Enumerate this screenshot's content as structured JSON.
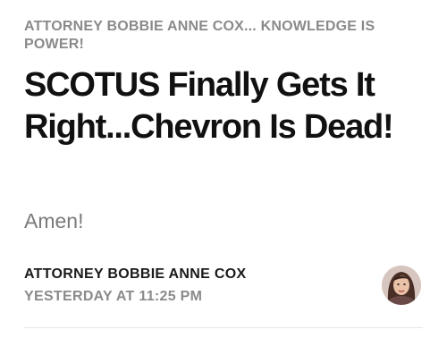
{
  "publication": {
    "name": "ATTORNEY BOBBIE ANNE COX... KNOWLEDGE IS POWER!"
  },
  "post": {
    "title": "SCOTUS Finally Gets It Right...Chevron Is Dead!",
    "subtitle": "Amen!"
  },
  "byline": {
    "author": "ATTORNEY BOBBIE ANNE COX",
    "timestamp": "YESTERDAY AT 11:25 PM"
  },
  "colors": {
    "text_primary": "#111111",
    "text_secondary": "#8a8a8a",
    "divider": "#e6e6e6"
  },
  "icons": {
    "avatar": "author-avatar"
  }
}
